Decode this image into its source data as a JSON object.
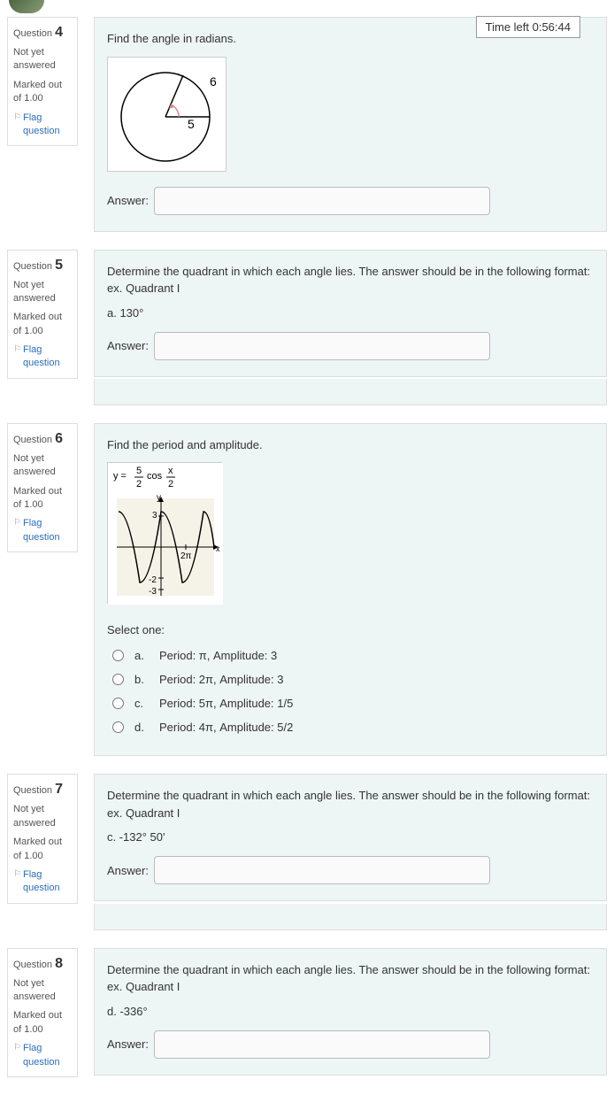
{
  "timer": {
    "label": "Time left 0:56:44"
  },
  "questions": [
    {
      "number": "4",
      "label": "Question",
      "status": "Not yet answered",
      "marked": "Marked out of 1.00",
      "flag": "Flag question",
      "prompt": "Find the angle in radians.",
      "diagram_arc": "6",
      "diagram_radius": "5",
      "answer_label": "Answer:"
    },
    {
      "number": "5",
      "label": "Question",
      "status": "Not yet answered",
      "marked": "Marked out of 1.00",
      "flag": "Flag question",
      "prompt": "Determine the quadrant in which each angle lies. The answer should be in the following format: ex. Quadrant I",
      "sub": "a. 130°",
      "answer_label": "Answer:"
    },
    {
      "number": "6",
      "label": "Question",
      "status": "Not yet answered",
      "marked": "Marked out of 1.00",
      "flag": "Flag question",
      "prompt": "Find the period and amplitude.",
      "formula_tex": "y = 5/2 cos x/2",
      "select_label": "Select one:",
      "options": [
        {
          "letter": "a.",
          "text": "Period: π, Amplitude: 3"
        },
        {
          "letter": "b.",
          "text": "Period: 2π, Amplitude: 3"
        },
        {
          "letter": "c.",
          "text": "Period: 5π, Amplitude: 1/5"
        },
        {
          "letter": "d.",
          "text": "Period: 4π, Amplitude: 5/2"
        }
      ]
    },
    {
      "number": "7",
      "label": "Question",
      "status": "Not yet answered",
      "marked": "Marked out of 1.00",
      "flag": "Flag question",
      "prompt": "Determine the quadrant in which each angle lies. The answer should be in the following format: ex. Quadrant I",
      "sub": "c. -132° 50'",
      "answer_label": "Answer:"
    },
    {
      "number": "8",
      "label": "Question",
      "status": "Not yet answered",
      "marked": "Marked out of 1.00",
      "flag": "Flag question",
      "prompt": "Determine the quadrant in which each angle lies. The answer should be in the following format: ex. Quadrant I",
      "sub": "d. -336°",
      "answer_label": "Answer:"
    }
  ]
}
